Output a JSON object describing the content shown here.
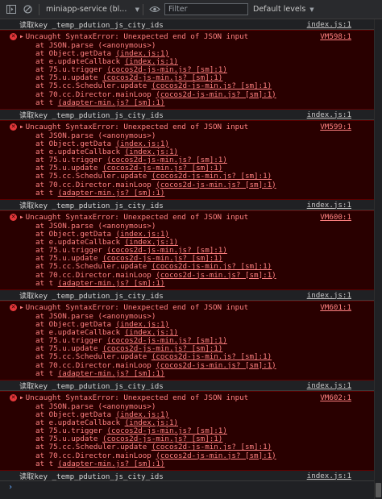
{
  "toolbar": {
    "context_label": "miniapp-service (bl...",
    "filter_placeholder": "Filter",
    "levels_label": "Default levels"
  },
  "info_rows": [
    {
      "message": "读取key _temp_pdution_js_city_ids",
      "source": "index.js:1"
    },
    {
      "message": "读取key _temp_pdution_js_city_ids",
      "source": "index.js:1"
    },
    {
      "message": "读取key _temp_pdution_js_city_ids",
      "source": "index.js:1"
    },
    {
      "message": "读取key _temp_pdution_js_city_ids",
      "source": "index.js:1"
    },
    {
      "message": "读取key _temp_pdution_js_city_ids",
      "source": "index.js:1"
    },
    {
      "message": "读取key _temp_pdution_js_city_ids",
      "source": "index.js:1"
    }
  ],
  "errors": [
    {
      "title": "Uncaught SyntaxError: Unexpected end of JSON input",
      "vm": "VM598:1"
    },
    {
      "title": "Uncaught SyntaxError: Unexpected end of JSON input",
      "vm": "VM599:1"
    },
    {
      "title": "Uncaught SyntaxError: Unexpected end of JSON input",
      "vm": "VM600:1"
    },
    {
      "title": "Uncaught SyntaxError: Unexpected end of JSON input",
      "vm": "VM601:1"
    },
    {
      "title": "Uncaught SyntaxError: Unexpected end of JSON input",
      "vm": "VM602:1"
    }
  ],
  "stack": [
    {
      "at": "at JSON.parse ",
      "src": "(<anonymous>)",
      "linked": false
    },
    {
      "at": "at Object.getData ",
      "src": "(index.js:1)",
      "linked": true
    },
    {
      "at": "at e.updateCallback ",
      "src": "(index.js:1)",
      "linked": true
    },
    {
      "at": "at 75.u.trigger ",
      "src": "(cocos2d-js-min.js? [sm]:1)",
      "linked": true
    },
    {
      "at": "at 75.u.update ",
      "src": "(cocos2d-js-min.js? [sm]:1)",
      "linked": true
    },
    {
      "at": "at 75.cc.Scheduler.update ",
      "src": "(cocos2d-js-min.js? [sm]:1)",
      "linked": true
    },
    {
      "at": "at 70.cc.Director.mainLoop ",
      "src": "(cocos2d-js-min.js? [sm]:1)",
      "linked": true
    },
    {
      "at": "at t ",
      "src": "(adapter-min.js? [sm]:1)",
      "linked": true
    }
  ],
  "prompt_symbol": "›"
}
